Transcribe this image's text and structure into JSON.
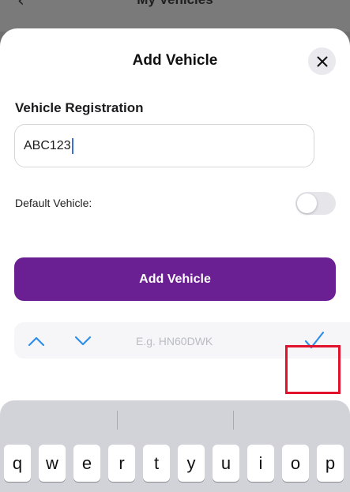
{
  "background": {
    "title": "My Vehicles",
    "back_icon": "chevron-left-icon"
  },
  "modal": {
    "title": "Add Vehicle",
    "close_icon": "close-icon"
  },
  "form": {
    "registration_label": "Vehicle Registration",
    "registration_value": "ABC123",
    "default_label": "Default Vehicle:",
    "default_on": false,
    "submit_label": "Add Vehicle"
  },
  "accessory_bar": {
    "prev_icon": "chevron-up-icon",
    "next_icon": "chevron-down-icon",
    "placeholder_hint": "E.g. HN60DWK",
    "done_icon": "checkmark-icon"
  },
  "keyboard": {
    "keys": [
      "q",
      "w",
      "e",
      "r",
      "t",
      "y",
      "u",
      "i",
      "o",
      "p"
    ]
  },
  "colors": {
    "accent_purple": "#6a1f92",
    "link_blue": "#2f8fe8",
    "highlight_red": "#e2122c"
  }
}
